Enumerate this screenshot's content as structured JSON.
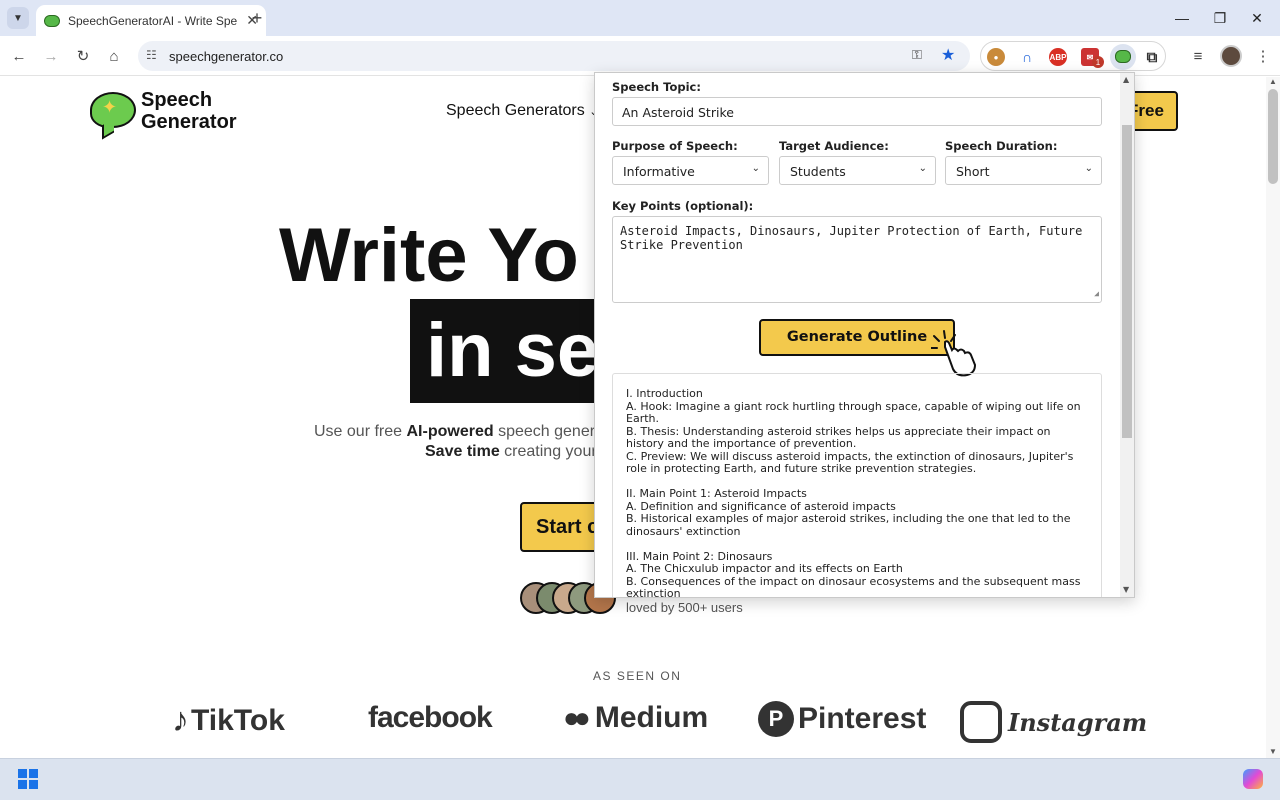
{
  "browser": {
    "tab_title": "SpeechGeneratorAI - Write Spe",
    "url": "speechgenerator.co",
    "ext_badge": "1",
    "ext_abp": "ABP"
  },
  "site": {
    "logo_line1": "Speech",
    "logo_line2": "Generator",
    "nav_generators": "Speech Generators",
    "cta_top": "Free",
    "hero_line1": "Write Yo",
    "hero_line2": "in se",
    "sub_before": "Use our free",
    "sub_bold": "AI-powered",
    "sub_after": "speech genera",
    "sub2_bold": "Save time",
    "sub2_after": "creating your",
    "start_btn": "Start c",
    "loved": "loved by 500+ users",
    "seen_on": "AS SEEN ON",
    "brands": [
      "TikTok",
      "facebook",
      "Medium",
      "Pinterest",
      "Instagram"
    ]
  },
  "popup": {
    "topic_label": "Speech Topic:",
    "topic_value": "An Asteroid Strike",
    "purpose_label": "Purpose of Speech:",
    "purpose_value": "Informative",
    "audience_label": "Target Audience:",
    "audience_value": "Students",
    "duration_label": "Speech Duration:",
    "duration_value": "Short",
    "keypoints_label": "Key Points (optional):",
    "keypoints_value": "Asteroid Impacts, Dinosaurs, Jupiter Protection of Earth, Future Strike Prevention",
    "generate_btn": "Generate Outline",
    "outline": [
      "I. Introduction",
      "A. Hook: Imagine a giant rock hurtling through space, capable of wiping out life on Earth.",
      "B. Thesis: Understanding asteroid strikes helps us appreciate their impact on history and the importance of prevention.",
      "C. Preview: We will discuss asteroid impacts, the extinction of dinosaurs, Jupiter's role in protecting Earth, and future strike prevention strategies.",
      "",
      "II. Main Point 1: Asteroid Impacts",
      "A. Definition and significance of asteroid impacts",
      "B. Historical examples of major asteroid strikes, including the one that led to the dinosaurs' extinction",
      "",
      "III. Main Point 2: Dinosaurs",
      "A. The Chicxulub impactor and its effects on Earth",
      "B. Consequences of the impact on dinosaur ecosystems and the subsequent mass extinction"
    ]
  }
}
